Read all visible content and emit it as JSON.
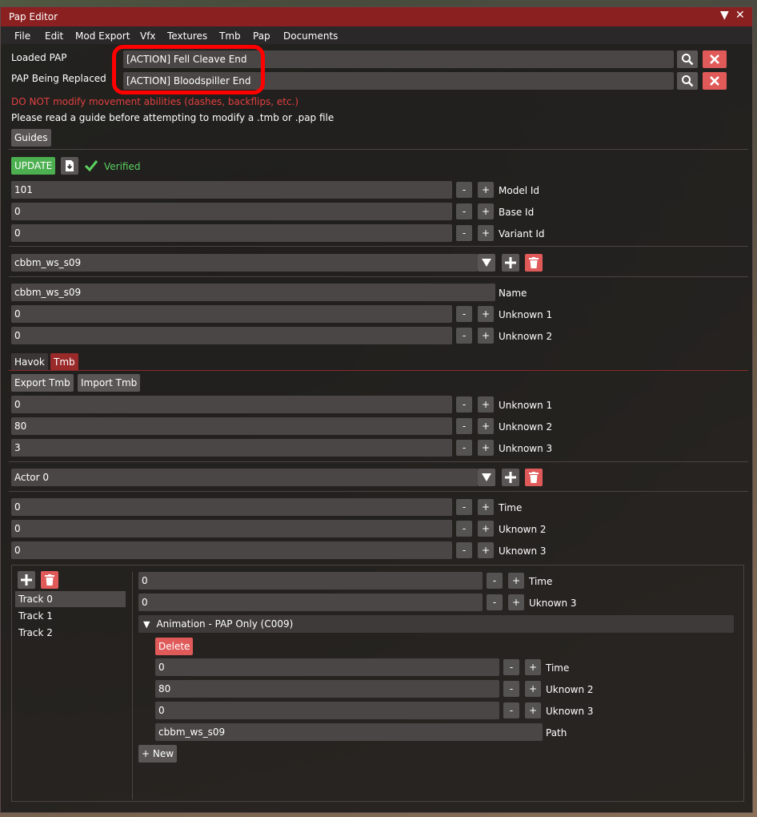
{
  "window": {
    "title": "Pap Editor",
    "collapse_icon": "▼",
    "close_icon": "✕"
  },
  "menu": [
    "File",
    "Edit",
    "Mod Export",
    "Vfx",
    "Textures",
    "Tmb",
    "Pap",
    "Documents"
  ],
  "loaded": {
    "label": "Loaded PAP",
    "value": "[ACTION] Fell Cleave End"
  },
  "replaced": {
    "label": "PAP Being Replaced",
    "value": "[ACTION] Bloodspiller End"
  },
  "warning": "DO NOT modify movement abilities (dashes, backflips, etc.)",
  "guide_note": "Please read a guide before attempting to modify a .tmb or .pap file",
  "guides_button": "Guides",
  "update_button": "UPDATE",
  "verified": "Verified",
  "ids": [
    {
      "value": "101",
      "label": "Model Id"
    },
    {
      "value": "0",
      "label": "Base Id"
    },
    {
      "value": "0",
      "label": "Variant Id"
    }
  ],
  "anim_select": "cbbm_ws_s09",
  "anim_name": {
    "value": "cbbm_ws_s09",
    "label": "Name"
  },
  "anim_fields": [
    {
      "value": "0",
      "label": "Unknown 1"
    },
    {
      "value": "0",
      "label": "Unknown 2"
    }
  ],
  "tabs": {
    "havok": "Havok",
    "tmb": "Tmb"
  },
  "export_tmb": "Export Tmb",
  "import_tmb": "Import Tmb",
  "tmb_fields": [
    {
      "value": "0",
      "label": "Unknown 1"
    },
    {
      "value": "80",
      "label": "Unknown 2"
    },
    {
      "value": "3",
      "label": "Unknown 3"
    }
  ],
  "actor_select": "Actor 0",
  "actor_fields": [
    {
      "value": "0",
      "label": "Time"
    },
    {
      "value": "0",
      "label": "Uknown 2"
    },
    {
      "value": "0",
      "label": "Uknown 3"
    }
  ],
  "tracks": [
    "Track 0",
    "Track 1",
    "Track 2"
  ],
  "track_fields": [
    {
      "value": "0",
      "label": "Time"
    },
    {
      "value": "0",
      "label": "Uknown 3"
    }
  ],
  "entry_header": "Animation - PAP Only (C009)",
  "delete_button": "Delete",
  "entry_fields": [
    {
      "value": "0",
      "label": "Time"
    },
    {
      "value": "80",
      "label": "Uknown 2"
    },
    {
      "value": "0",
      "label": "Uknown 3"
    }
  ],
  "entry_path": {
    "value": "cbbm_ws_s09",
    "label": "Path"
  },
  "new_button": "+ New",
  "stepper": {
    "minus": "-",
    "plus": "+"
  },
  "colors": {
    "accent_red": "#8a2020",
    "warning": "#e04040",
    "verified_green": "#5cd060",
    "update_green": "#4caf50",
    "delete_red": "#e05a5a"
  },
  "icons": [
    "search-icon",
    "close-icon",
    "file-download-icon",
    "checkmark-icon",
    "chevron-down-icon",
    "plus-icon",
    "trash-icon"
  ]
}
